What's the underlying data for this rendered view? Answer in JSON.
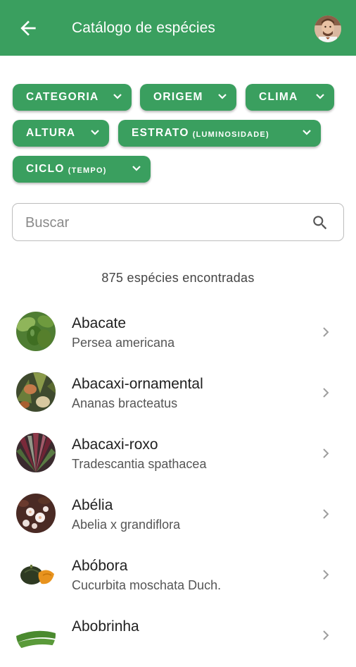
{
  "appbar": {
    "title": "Catálogo de espécies",
    "back_icon": "arrow-back-icon",
    "avatar_icon": "user-avatar"
  },
  "filters": [
    {
      "label": "CATEGORIA",
      "sub": ""
    },
    {
      "label": "ORIGEM",
      "sub": ""
    },
    {
      "label": "CLIMA",
      "sub": ""
    },
    {
      "label": "ALTURA",
      "sub": ""
    },
    {
      "label": "ESTRATO",
      "sub": "(LUMINOSIDADE)"
    },
    {
      "label": "CICLO",
      "sub": "(TEMPO)"
    }
  ],
  "search": {
    "placeholder": "Buscar",
    "value": ""
  },
  "results_count": "875 espécies encontradas",
  "species": [
    {
      "name": "Abacate",
      "scientific": "Persea americana"
    },
    {
      "name": "Abacaxi-ornamental",
      "scientific": "Ananas bracteatus"
    },
    {
      "name": "Abacaxi-roxo",
      "scientific": "Tradescantia spathacea"
    },
    {
      "name": "Abélia",
      "scientific": "Abelia x grandiflora"
    },
    {
      "name": "Abóbora",
      "scientific": "Cucurbita moschata Duch."
    },
    {
      "name": "Abobrinha",
      "scientific": ""
    }
  ],
  "colors": {
    "primary": "#3a9f5f",
    "chip_text": "#ffffff"
  }
}
